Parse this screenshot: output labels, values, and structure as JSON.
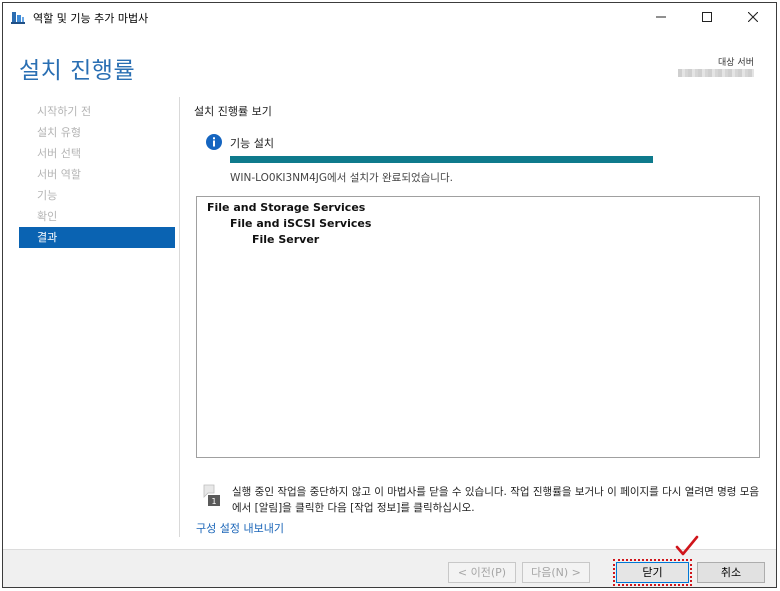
{
  "window": {
    "title": "역할 및 기능 추가 마법사"
  },
  "header": {
    "page_title": "설치 진행률",
    "target_label": "대상 서버"
  },
  "nav": {
    "items": [
      {
        "label": "시작하기 전",
        "active": false
      },
      {
        "label": "설치 유형",
        "active": false
      },
      {
        "label": "서버 선택",
        "active": false
      },
      {
        "label": "서버 역할",
        "active": false
      },
      {
        "label": "기능",
        "active": false
      },
      {
        "label": "확인",
        "active": false
      },
      {
        "label": "결과",
        "active": true
      }
    ]
  },
  "content": {
    "section_heading": "설치 진행률 보기",
    "status_label": "기능 설치",
    "progress": 1.0,
    "result_text": "WIN-LO0KI3NM4JG에서 설치가 완료되었습니다.",
    "results_tree": [
      {
        "label": "File and Storage Services",
        "level": 0
      },
      {
        "label": "File and iSCSI Services",
        "level": 1
      },
      {
        "label": "File Server",
        "level": 2
      }
    ],
    "note_text": "실행 중인 작업을 중단하지 않고 이 마법사를 닫을 수 있습니다. 작업 진행률을 보거나 이 페이지를 다시 열려면 명령 모음에서 [알림]을 클릭한 다음 [작업 정보]를 클릭하십시오.",
    "export_link": "구성 설정 내보내기"
  },
  "footer": {
    "prev_label": "< 이전(P)",
    "next_label": "다음(N) >",
    "close_label": "닫기",
    "cancel_label": "취소"
  },
  "colors": {
    "accent": "#0a63b2",
    "progress": "#0e7a8c",
    "title": "#2a6fb3",
    "highlight": "#d0151b"
  },
  "icons": {
    "app": "server-manager-icon",
    "info": "info-icon",
    "note": "flag-note-icon",
    "annotation": "checkmark-icon"
  }
}
